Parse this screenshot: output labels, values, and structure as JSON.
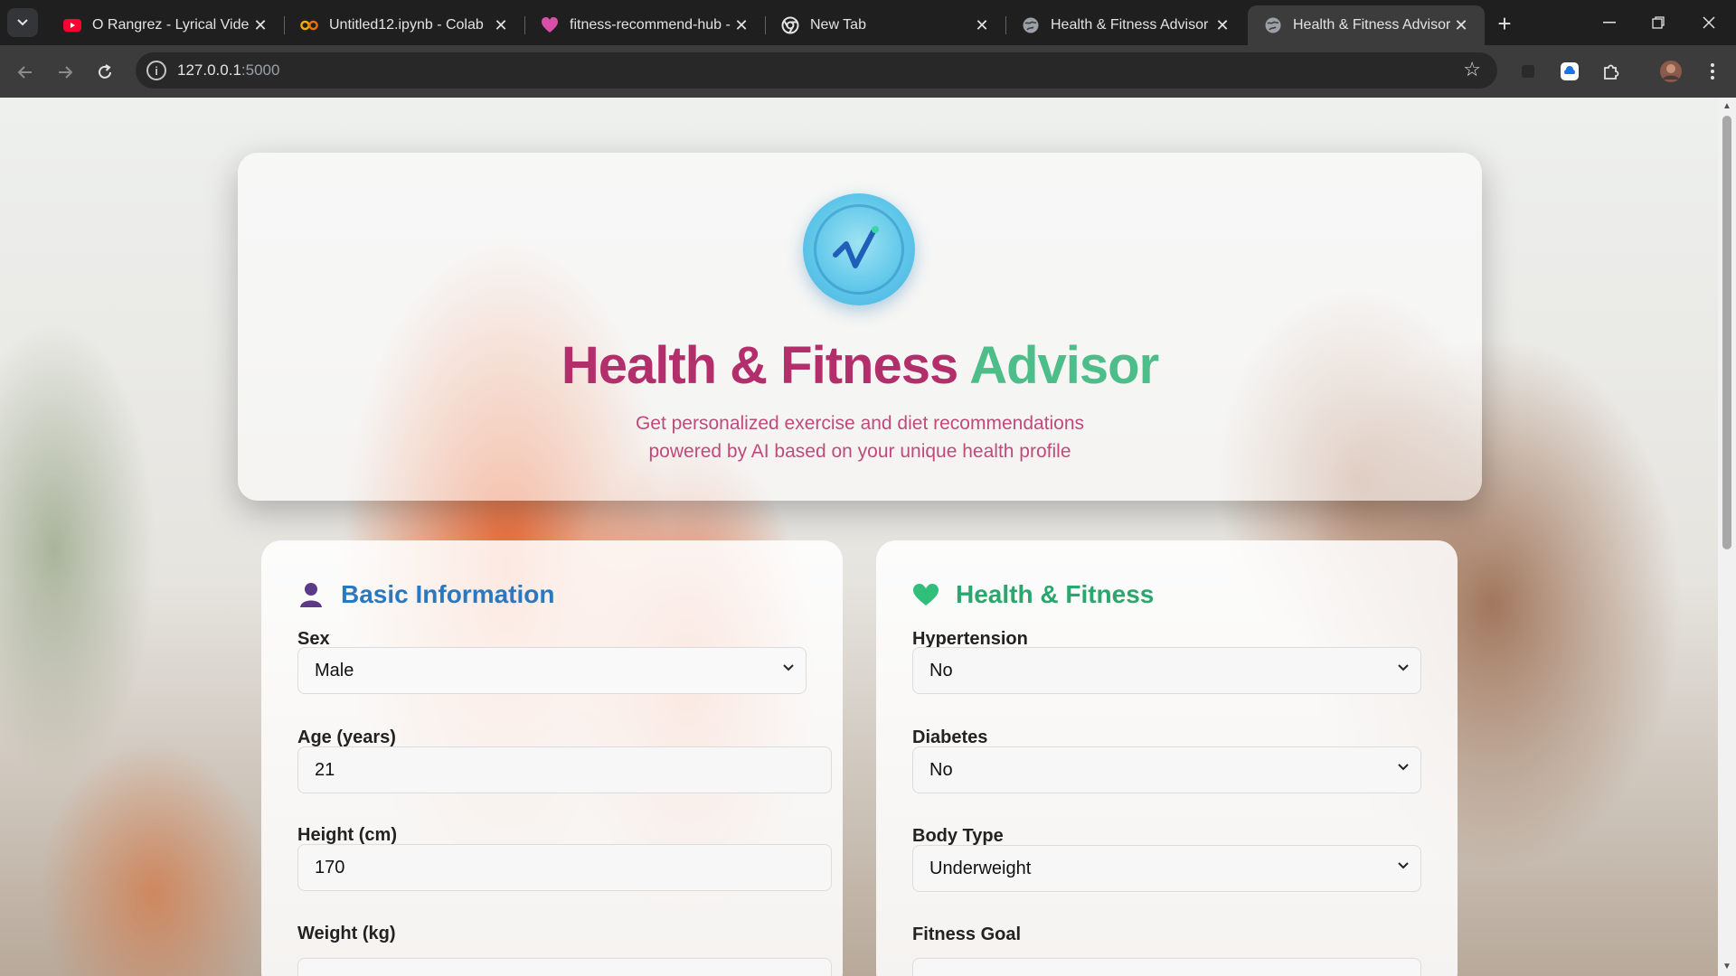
{
  "browser": {
    "tabs": [
      {
        "title": "O Rangrez - Lyrical Video |",
        "favicon": "youtube-icon"
      },
      {
        "title": "Untitled12.ipynb - Colab",
        "favicon": "colab-icon"
      },
      {
        "title": "fitness-recommend-hub - ",
        "favicon": "heart-app-icon"
      },
      {
        "title": "New Tab",
        "favicon": "chrome-icon"
      },
      {
        "title": "Health & Fitness Advisor",
        "favicon": "globe-icon"
      },
      {
        "title": "Health & Fitness Advisor",
        "favicon": "globe-icon",
        "active": true
      }
    ],
    "url_host": "127.0.0.1",
    "url_port": ":5000"
  },
  "hero": {
    "title_part1": "Health & Fitness",
    "title_part2": "Advisor",
    "subtitle": "Get personalized exercise and diet recommendations powered by AI based on your unique health profile"
  },
  "basic_info": {
    "heading": "Basic Information",
    "sex_label": "Sex",
    "sex_value": "Male",
    "age_label": "Age (years)",
    "age_value": "21",
    "height_label": "Height (cm)",
    "height_value": "170",
    "weight_label": "Weight (kg)"
  },
  "health_fitness": {
    "heading": "Health & Fitness",
    "hypertension_label": "Hypertension",
    "hypertension_value": "No",
    "diabetes_label": "Diabetes",
    "diabetes_value": "No",
    "body_type_label": "Body Type",
    "body_type_value": "Underweight",
    "fitness_goal_label": "Fitness Goal"
  },
  "colors": {
    "title_magenta": "#b22f6b",
    "title_green": "#4dbd8a",
    "basic_heading": "#2a78c0",
    "health_heading": "#2aa66e"
  }
}
